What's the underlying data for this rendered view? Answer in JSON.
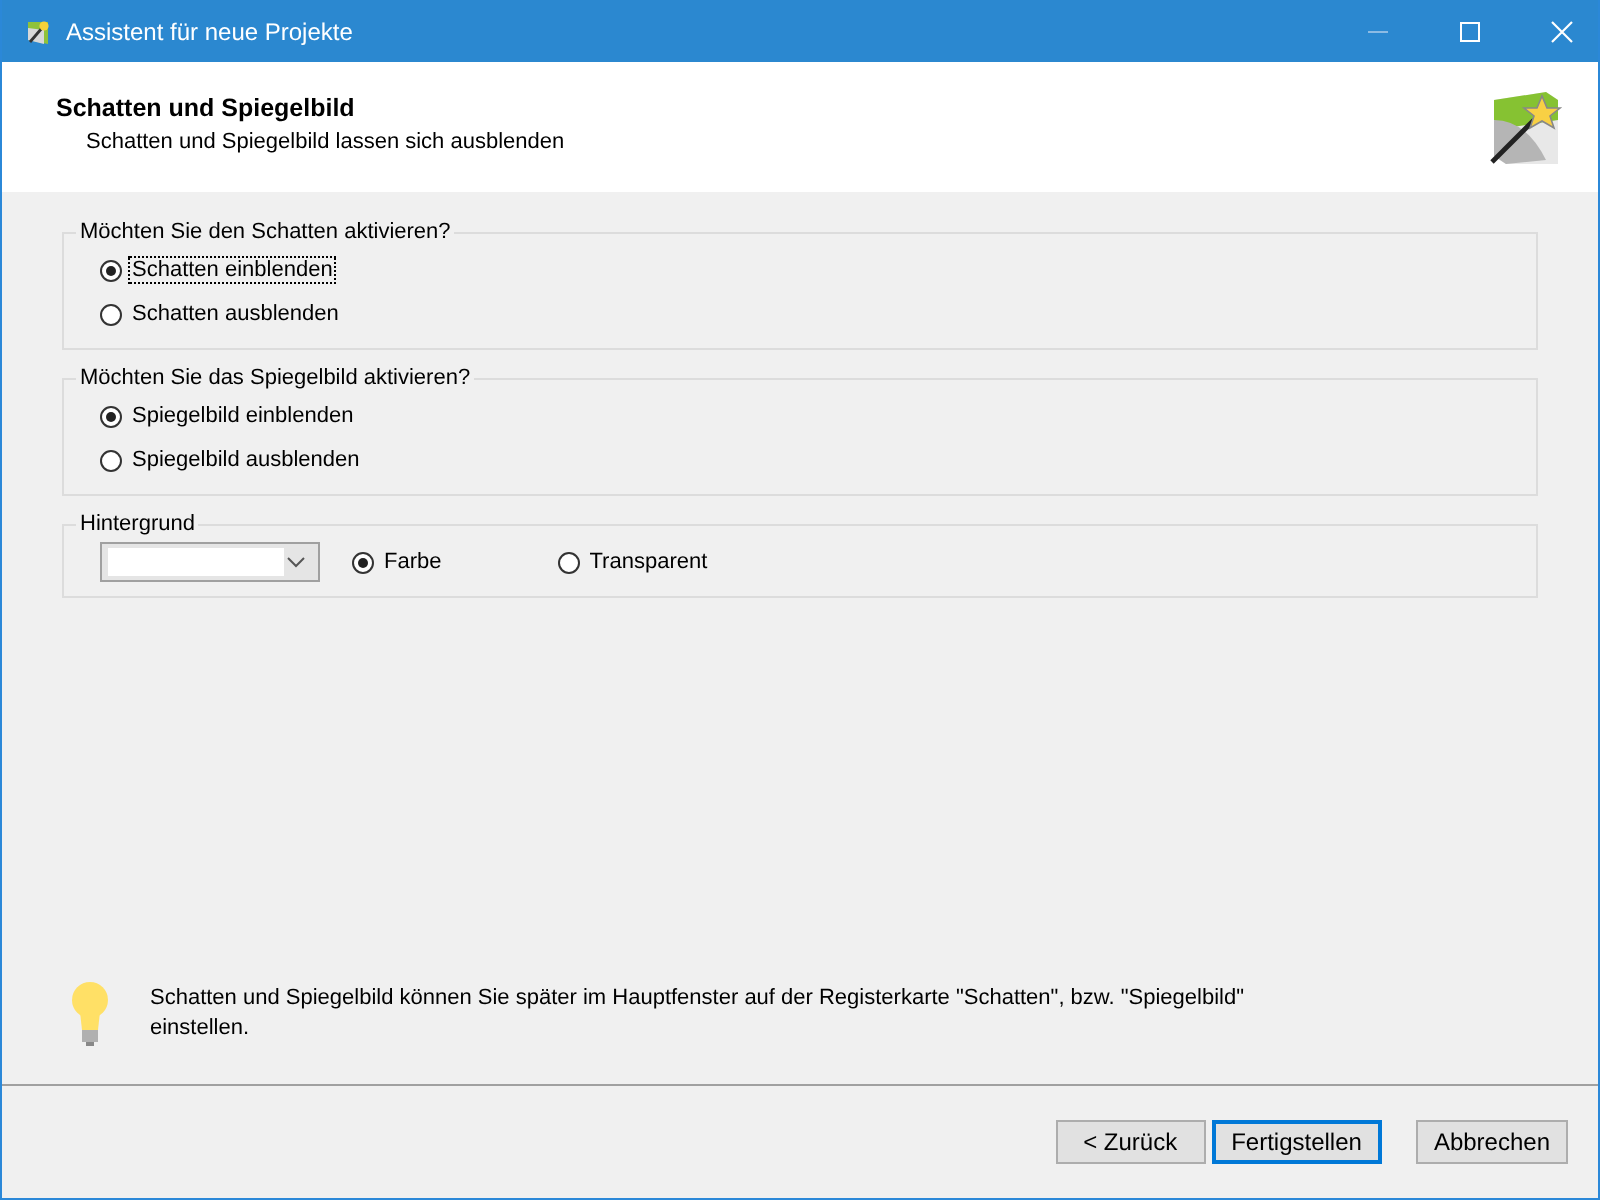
{
  "window": {
    "title": "Assistent für neue Projekte"
  },
  "header": {
    "title": "Schatten und Spiegelbild",
    "subtitle": "Schatten und Spiegelbild lassen sich ausblenden"
  },
  "groups": [
    {
      "legend": "Möchten Sie den Schatten aktivieren?",
      "options": [
        {
          "label": "Schatten einblenden",
          "selected": true,
          "focused": true
        },
        {
          "label": "Schatten ausblenden",
          "selected": false,
          "focused": false
        }
      ]
    },
    {
      "legend": "Möchten Sie das Spiegelbild aktivieren?",
      "options": [
        {
          "label": "Spiegelbild einblenden",
          "selected": true,
          "focused": false
        },
        {
          "label": "Spiegelbild ausblenden",
          "selected": false,
          "focused": false
        }
      ]
    }
  ],
  "background": {
    "legend": "Hintergrund",
    "options": [
      {
        "label": "Farbe",
        "selected": true
      },
      {
        "label": "Transparent",
        "selected": false
      }
    ]
  },
  "hint": "Schatten und Spiegelbild können Sie später im Hauptfenster auf der Registerkarte \"Schatten\", bzw. \"Spiegelbild\" einstellen.",
  "buttons": [
    {
      "label": "< Zurück",
      "default": false
    },
    {
      "label": "Fertigstellen",
      "default": true
    },
    {
      "label": "Abbrechen",
      "default": false
    }
  ]
}
